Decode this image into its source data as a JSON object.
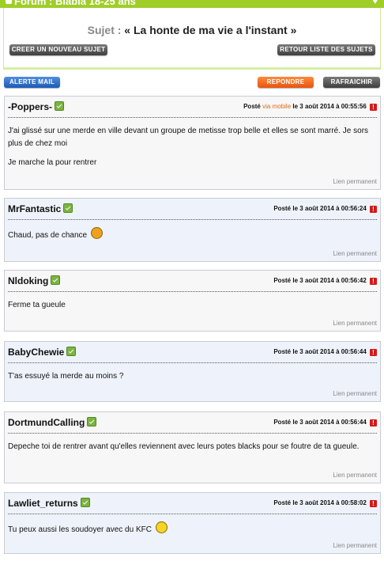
{
  "header": {
    "forum_title": "Forum : Blabla 18-25 ans",
    "subject_label": "Sujet :",
    "subject_title": "« La honte de ma vie a l'instant »"
  },
  "buttons": {
    "create_topic": "CREER UN NOUVEAU SUJET",
    "back_to_list": "RETOUR LISTE DES SUJETS",
    "mail_alert": "ALERTE MAIL",
    "reply": "REPONDRE",
    "refresh": "RAFRAICHIR"
  },
  "posts": [
    {
      "author": "-Poppers-",
      "posted_prefix": "Posté",
      "via": "via mobile",
      "date_text": "le 3 août 2014 à 00:55:56",
      "paragraphs": [
        "J'ai glissé sur une merde en ville devant un groupe de metisse trop belle et elles se sont marré. Je sors plus de chez moi",
        "Je marche la pour rentrer"
      ],
      "permalink": "Lien permanent"
    },
    {
      "author": "MrFantastic",
      "posted_prefix": "Posté",
      "date_text": "le 3 août 2014 à 00:56:24",
      "paragraphs": [
        "Chaud, pas de chance"
      ],
      "smiley": "angry-smiley-icon",
      "permalink": "Lien permanent"
    },
    {
      "author": "Nldoking",
      "posted_prefix": "Posté",
      "date_text": "le 3 août 2014 à 00:56:42",
      "paragraphs": [
        "Ferme ta gueule"
      ],
      "permalink": "Lien permanent"
    },
    {
      "author": "BabyChewie",
      "posted_prefix": "Posté",
      "date_text": "le 3 août 2014 à 00:56:44",
      "paragraphs": [
        "T'as essuyé la merde au moins ?"
      ],
      "permalink": "Lien permanent"
    },
    {
      "author": "DortmundCalling",
      "posted_prefix": "Posté",
      "date_text": "le 3 août 2014 à 00:56:44",
      "paragraphs": [
        "Depeche toi de rentrer avant qu'elles reviennent avec leurs potes blacks pour se foutre de ta gueule."
      ],
      "permalink": "Lien permanent"
    },
    {
      "author": "Lawliet_returns",
      "posted_prefix": "Posté",
      "date_text": "le 3 août 2014 à 00:58:02",
      "paragraphs": [
        "Tu peux aussi les soudoyer avec du KFC"
      ],
      "smiley": "smile-smiley-icon",
      "permalink": "Lien permanent"
    }
  ],
  "colors": {
    "header_green": "#9fce29",
    "post_alt_bg": "#eef3fb",
    "post_bg": "#f7f7f7",
    "mobile_orange": "#e06a10",
    "alert_red": "#d21a1a"
  }
}
